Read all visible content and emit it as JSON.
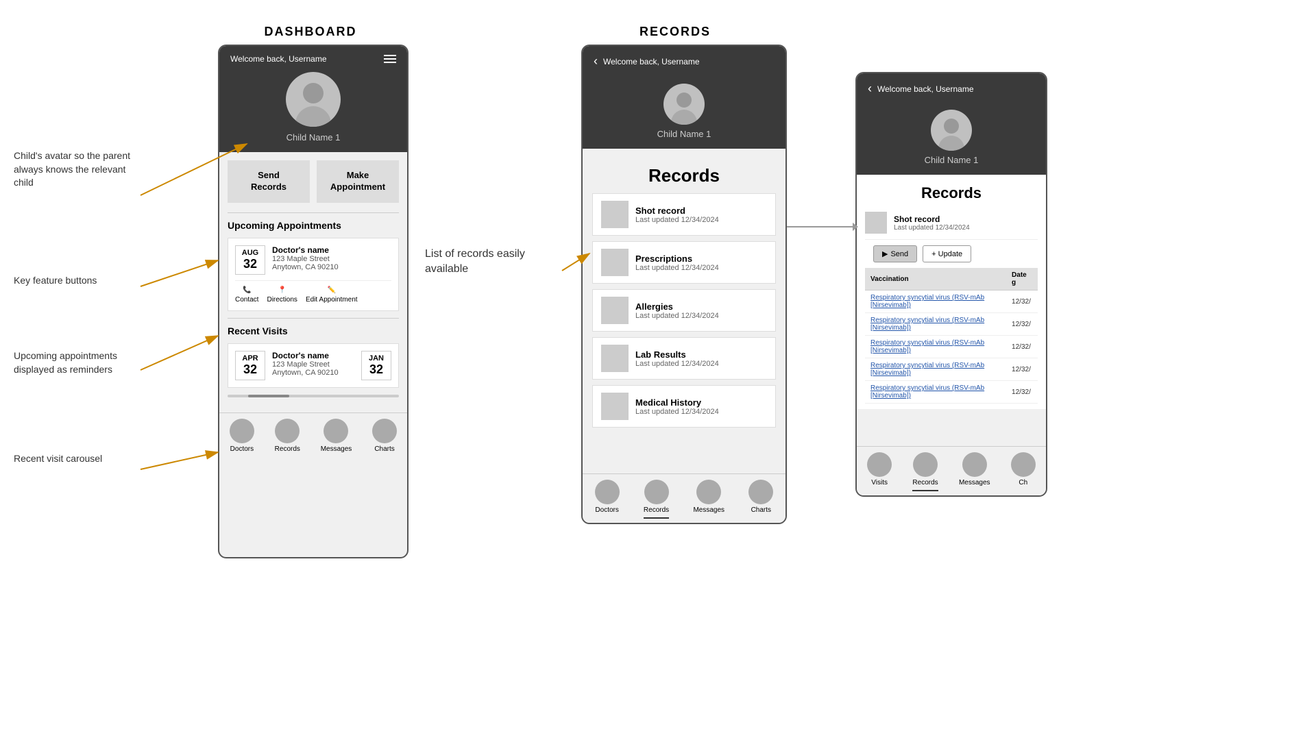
{
  "page": {
    "background": "#ffffff"
  },
  "dashboard": {
    "section_title": "DASHBOARD",
    "header": {
      "welcome": "Welcome back, Username"
    },
    "child_name": "Child Name 1",
    "feature_buttons": [
      {
        "label": "Send\nRecords"
      },
      {
        "label": "Make\nAppointment"
      }
    ],
    "upcoming_appointments": {
      "title": "Upcoming Appointments",
      "item": {
        "month": "AUG",
        "day": "32",
        "doctor": "Doctor's name",
        "address_line1": "123 Maple Street",
        "address_line2": "Anytown, CA 90210",
        "actions": [
          "Contact",
          "Directions",
          "Edit Appointment"
        ]
      }
    },
    "recent_visits": {
      "title": "Recent Visits",
      "item": {
        "month1": "APR",
        "day1": "32",
        "doctor": "Doctor's name",
        "address_line1": "123 Maple Street",
        "address_line2": "Anytown, CA 90210",
        "month2": "JAN",
        "day2": "32"
      }
    },
    "nav": {
      "items": [
        "Doctors",
        "Records",
        "Messages",
        "Charts"
      ]
    }
  },
  "records_screen": {
    "section_title": "RECORDS",
    "header": {
      "welcome": "Welcome back, Username"
    },
    "child_name": "Child Name 1",
    "title": "Records",
    "list": [
      {
        "name": "Shot record",
        "updated": "Last updated 12/34/2024"
      },
      {
        "name": "Prescriptions",
        "updated": "Last updated 12/34/2024"
      },
      {
        "name": "Allergies",
        "updated": "Last updated 12/34/2024"
      },
      {
        "name": "Lab Results",
        "updated": "Last updated 12/34/2024"
      },
      {
        "name": "Medical History",
        "updated": "Last updated 12/34/2024"
      }
    ],
    "nav": {
      "items": [
        "Doctors",
        "Records",
        "Messages",
        "Charts"
      ],
      "active": "Records"
    }
  },
  "shot_detail_screen": {
    "header": {
      "welcome": "Welcome back, Username"
    },
    "child_name": "Child Name 1",
    "title": "Records",
    "shot_record_label": "Shot record",
    "last_updated": "Last updated 12/34/2024",
    "send_label": "Send",
    "update_label": "+ Update",
    "table": {
      "col1": "Vaccination",
      "col2": "Date g",
      "rows": [
        {
          "vaccination": "Respiratory syncytial virus (RSV-mAb [Nirsevimab])",
          "date": "12/32/"
        },
        {
          "vaccination": "Respiratory syncytial virus (RSV-mAb [Nirsevimab])",
          "date": "12/32/"
        },
        {
          "vaccination": "Respiratory syncytial virus (RSV-mAb [Nirsevimab])",
          "date": "12/32/"
        },
        {
          "vaccination": "Respiratory syncytial virus (RSV-mAb [Nirsevimab])",
          "date": "12/32/"
        },
        {
          "vaccination": "Respiratory syncytial virus (RSV-mAb [Nirsevimab])",
          "date": "12/32/"
        }
      ]
    },
    "nav": {
      "items": [
        "Visits",
        "Records",
        "Messages",
        "Ch"
      ],
      "active": "Records"
    }
  },
  "annotations": {
    "child_avatar": "Child's avatar so the parent always knows the relevant child",
    "key_features": "Key feature buttons",
    "upcoming": "Upcoming appointments displayed as reminders",
    "recent_visits": "Recent visit carousel",
    "list_records": "List of records\neasily available"
  }
}
